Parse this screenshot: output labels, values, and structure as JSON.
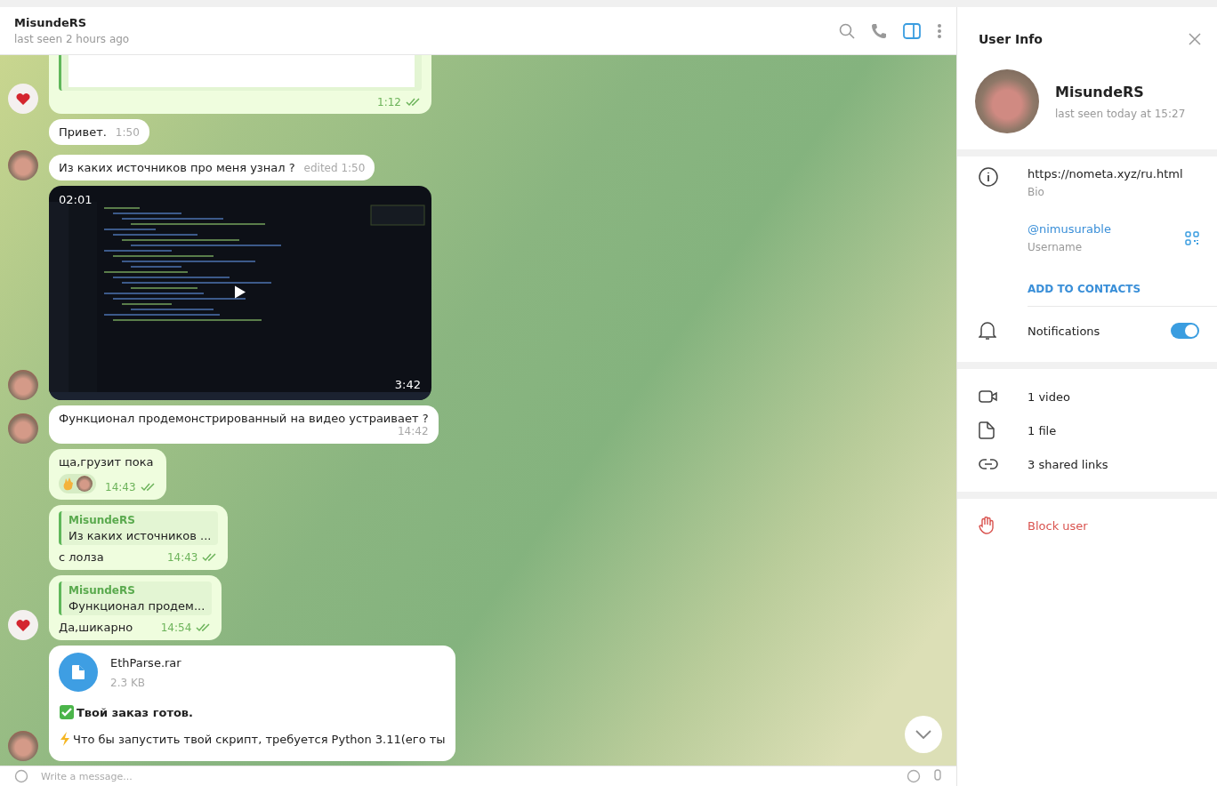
{
  "chat_header": {
    "name": "MisundeRS",
    "status": "last seen 2 hours ago"
  },
  "messages": [
    {
      "kind": "card",
      "outgoing": true,
      "avatar": true,
      "time": "1:12",
      "read": true
    },
    {
      "kind": "text",
      "outgoing": false,
      "avatar": false,
      "text": "Привет.",
      "time": "1:50"
    },
    {
      "kind": "text",
      "outgoing": false,
      "avatar": true,
      "text": "Из каких источников про меня узнал ?",
      "time": "edited 1:50"
    },
    {
      "kind": "video",
      "outgoing": false,
      "avatar": true,
      "position": "02:01",
      "length": "3:42"
    },
    {
      "kind": "text",
      "outgoing": false,
      "avatar": true,
      "text": "Функционал продемонстрированный на видео устраивает ?",
      "time": "14:42",
      "wide": true
    },
    {
      "kind": "text",
      "outgoing": true,
      "avatar": false,
      "text": "ща,грузит пока",
      "time": "14:43",
      "read": true,
      "reactions": true
    },
    {
      "kind": "reply",
      "outgoing": true,
      "avatar": false,
      "reply_name": "MisundeRS",
      "reply_text": "Из каких источников ...",
      "text": "с лолза",
      "time": "14:43",
      "read": true
    },
    {
      "kind": "reply",
      "outgoing": true,
      "avatar": true,
      "reply_name": "MisundeRS",
      "reply_text": "Функционал продем...",
      "text": "Да,шикарно",
      "time": "14:54",
      "read": true
    },
    {
      "kind": "file",
      "outgoing": false,
      "avatar": true,
      "file_name": "EthParse.rar",
      "file_size": "2.3 KB",
      "lines": [
        {
          "kind": "headline",
          "text": "Твой заказ готов."
        },
        {
          "kind": "note",
          "text": "Что бы запустить твой скрипт, требуется Python 3.11(его ты"
        }
      ]
    }
  ],
  "composer": {
    "placeholder": "Write a message..."
  },
  "user_info": {
    "title": "User Info",
    "name": "MisundeRS",
    "status": "last seen today at 15:27",
    "bio": {
      "value": "https://nometa.xyz/ru.html",
      "label": "Bio"
    },
    "username": {
      "value": "@nimusurable",
      "label": "Username"
    },
    "add_contact": "ADD TO CONTACTS",
    "notifications": {
      "label": "Notifications",
      "on": true
    },
    "media": [
      {
        "kind": "video",
        "label": "1 video"
      },
      {
        "kind": "file",
        "label": "1 file"
      },
      {
        "kind": "link",
        "label": "3 shared links"
      }
    ],
    "block": "Block user"
  }
}
